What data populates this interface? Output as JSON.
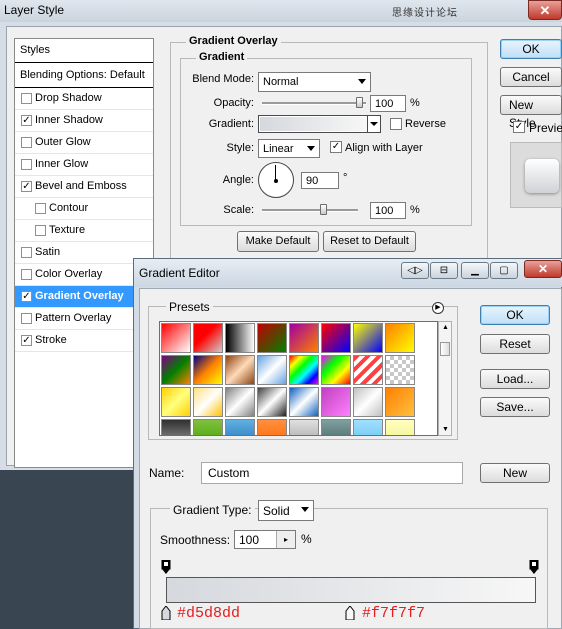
{
  "layer_style": {
    "title": "Layer Style",
    "watermark": "思缘设计论坛",
    "close": "✕",
    "styles_header": "Styles",
    "blending": "Blending Options: Default",
    "items": [
      {
        "label": "Drop Shadow",
        "checked": false
      },
      {
        "label": "Inner Shadow",
        "checked": true
      },
      {
        "label": "Outer Glow",
        "checked": false
      },
      {
        "label": "Inner Glow",
        "checked": false
      },
      {
        "label": "Bevel and Emboss",
        "checked": true
      },
      {
        "label": "Contour",
        "checked": false
      },
      {
        "label": "Texture",
        "checked": false
      },
      {
        "label": "Satin",
        "checked": false
      },
      {
        "label": "Color Overlay",
        "checked": false
      },
      {
        "label": "Gradient Overlay",
        "checked": true
      },
      {
        "label": "Pattern Overlay",
        "checked": false
      },
      {
        "label": "Stroke",
        "checked": true
      }
    ],
    "panel_title": "Gradient Overlay",
    "group_title": "Gradient",
    "blend_mode_label": "Blend Mode:",
    "blend_mode": "Normal",
    "opacity_label": "Opacity:",
    "opacity": "100",
    "opacity_unit": "%",
    "gradient_label": "Gradient:",
    "reverse_label": "Reverse",
    "style_label": "Style:",
    "style": "Linear",
    "align_label": "Align with Layer",
    "angle_label": "Angle:",
    "angle": "90",
    "angle_unit": "°",
    "scale_label": "Scale:",
    "scale": "100",
    "scale_unit": "%",
    "make_default": "Make Default",
    "reset_default": "Reset to Default",
    "ok": "OK",
    "cancel": "Cancel",
    "new_style": "New Style",
    "preview": "Previe"
  },
  "gradient_editor": {
    "title": "Gradient Editor",
    "close": "✕",
    "presets_label": "Presets",
    "ok": "OK",
    "reset": "Reset",
    "load": "Load...",
    "save": "Save...",
    "name_label": "Name:",
    "name_value": "Custom",
    "new": "New",
    "gradient_type_label": "Gradient Type:",
    "gradient_type": "Solid",
    "smoothness_label": "Smoothness:",
    "smoothness": "100",
    "smoothness_unit": "%",
    "stop_left_color": "#d5d8dd",
    "stop_right_color": "#f7f7f7"
  }
}
